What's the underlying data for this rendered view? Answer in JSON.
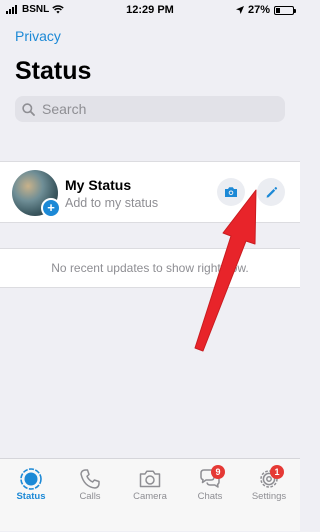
{
  "status_bar": {
    "carrier": "BSNL",
    "time": "12:29 PM",
    "battery": "27%",
    "battery_level": 0.27,
    "icons": [
      "signal-icon",
      "wifi-icon",
      "location-arrow-icon",
      "battery-icon"
    ]
  },
  "header": {
    "back_link": "Privacy",
    "title": "Status"
  },
  "search": {
    "placeholder": "Search"
  },
  "my_status": {
    "name": "My Status",
    "subtitle": "Add to my status",
    "avatar_badge": "+",
    "actions": [
      "camera-icon",
      "pencil-icon"
    ]
  },
  "updates": {
    "empty_message": "No recent updates to show right now."
  },
  "tabs": [
    {
      "label": "Status",
      "icon": "status-icon",
      "active": true,
      "badge": ""
    },
    {
      "label": "Calls",
      "icon": "phone-icon",
      "active": false,
      "badge": ""
    },
    {
      "label": "Camera",
      "icon": "camera-icon",
      "active": false,
      "badge": ""
    },
    {
      "label": "Chats",
      "icon": "chat-bubbles-icon",
      "active": false,
      "badge": "9"
    },
    {
      "label": "Settings",
      "icon": "gear-icon",
      "active": false,
      "badge": "1"
    }
  ],
  "colors": {
    "accent": "#1c89d6",
    "background": "#efeff4",
    "badge": "#e53935",
    "annotation_arrow": "#e8242a"
  }
}
